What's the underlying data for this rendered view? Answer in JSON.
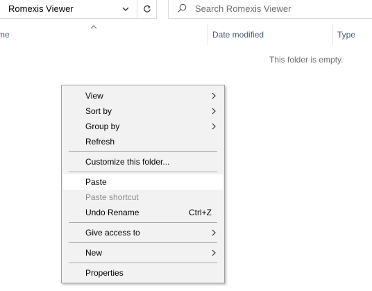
{
  "address": {
    "path": "Romexis Viewer",
    "dropdown_icon": "chevron-down-icon",
    "refresh_icon": "refresh-icon"
  },
  "search": {
    "placeholder": "Search Romexis Viewer",
    "icon": "search-icon"
  },
  "columns": {
    "name": "me",
    "date_modified": "Date modified",
    "type": "Type"
  },
  "empty_message": "This folder is empty.",
  "context_menu": {
    "view": "View",
    "sort_by": "Sort by",
    "group_by": "Group by",
    "refresh": "Refresh",
    "customize": "Customize this folder...",
    "paste": "Paste",
    "paste_shortcut": "Paste shortcut",
    "undo_rename": "Undo Rename",
    "undo_rename_shortcut": "Ctrl+Z",
    "give_access": "Give access to",
    "new": "New",
    "properties": "Properties"
  }
}
